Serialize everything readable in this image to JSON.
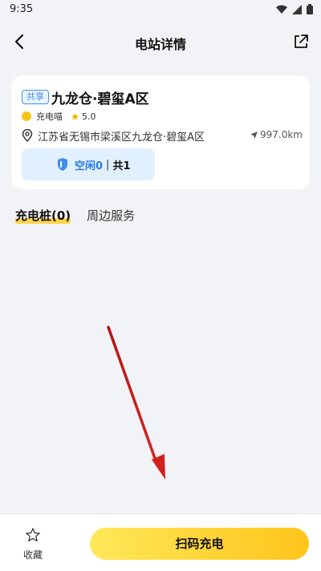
{
  "status": {
    "time": "9:35"
  },
  "header": {
    "title": "电站详情"
  },
  "station": {
    "tag": "共享",
    "name": "九龙仓·碧玺A区",
    "operator": "充电喵",
    "rating": "5.0",
    "address": "江苏省无锡市梁溪区九龙仓·碧玺A区",
    "distance": "997.0km",
    "availability": {
      "free": "空闲0",
      "separator": "|",
      "total": "共1"
    }
  },
  "tabs": [
    {
      "label": "充电桩(0)",
      "active": true
    },
    {
      "label": "周边服务",
      "active": false
    }
  ],
  "bottom": {
    "favorite_label": "收藏",
    "scan_label": "扫码充电"
  },
  "colors": {
    "accent_yellow": "#ffc41a",
    "accent_blue": "#2b7ae0",
    "annotation_arrow": "#d21f1f"
  }
}
